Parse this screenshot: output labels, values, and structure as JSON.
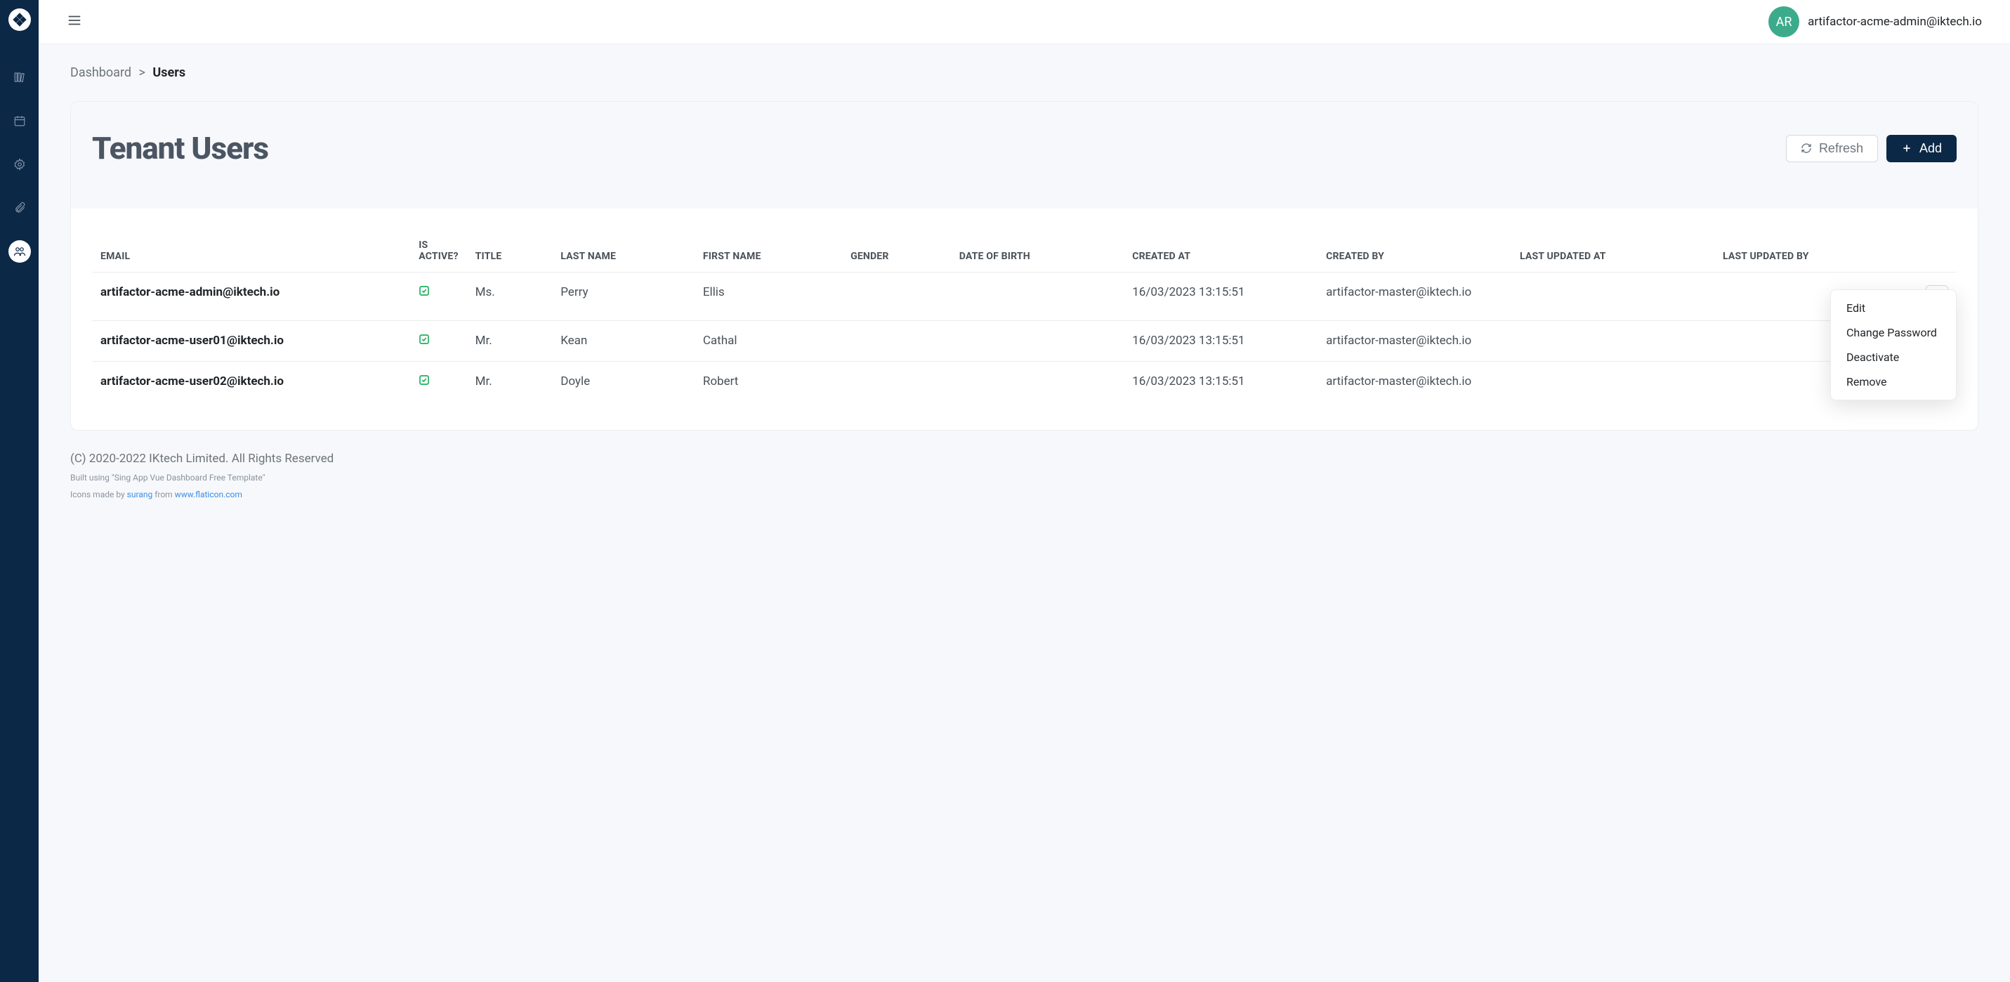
{
  "header": {
    "avatar_initials": "AR",
    "user_email": "artifactor-acme-admin@iktech.io"
  },
  "breadcrumb": {
    "root": "Dashboard",
    "separator": ">",
    "current": "Users"
  },
  "page": {
    "title": "Tenant Users",
    "refresh_label": "Refresh",
    "add_label": "Add"
  },
  "table": {
    "headers": {
      "email": "EMAIL",
      "is_active": "IS ACTIVE?",
      "title": "TITLE",
      "last_name": "LAST NAME",
      "first_name": "FIRST NAME",
      "gender": "GENDER",
      "dob": "DATE OF BIRTH",
      "created_at": "CREATED AT",
      "created_by": "CREATED BY",
      "last_updated_at": "LAST UPDATED AT",
      "last_updated_by": "LAST UPDATED BY"
    },
    "rows": [
      {
        "email": "artifactor-acme-admin@iktech.io",
        "is_active": true,
        "title": "Ms.",
        "last_name": "Perry",
        "first_name": "Ellis",
        "gender": "",
        "dob": "",
        "created_at": "16/03/2023 13:15:51",
        "created_by": "artifactor-master@iktech.io",
        "last_updated_at": "",
        "last_updated_by": ""
      },
      {
        "email": "artifactor-acme-user01@iktech.io",
        "is_active": true,
        "title": "Mr.",
        "last_name": "Kean",
        "first_name": "Cathal",
        "gender": "",
        "dob": "",
        "created_at": "16/03/2023 13:15:51",
        "created_by": "artifactor-master@iktech.io",
        "last_updated_at": "",
        "last_updated_by": ""
      },
      {
        "email": "artifactor-acme-user02@iktech.io",
        "is_active": true,
        "title": "Mr.",
        "last_name": "Doyle",
        "first_name": "Robert",
        "gender": "",
        "dob": "",
        "created_at": "16/03/2023 13:15:51",
        "created_by": "artifactor-master@iktech.io",
        "last_updated_at": "",
        "last_updated_by": ""
      }
    ]
  },
  "dropdown": {
    "items": [
      "Edit",
      "Change Password",
      "Deactivate",
      "Remove"
    ]
  },
  "footer": {
    "copyright": "(C) 2020-2022 IKtech Limited. All Rights Reserved",
    "built_prefix": "Built using \"Sing App Vue Dashboard Free Template\"",
    "icons_prefix": "Icons made by ",
    "icons_author": "surang",
    "icons_from": " from ",
    "icons_site": "www.flaticon.com"
  }
}
